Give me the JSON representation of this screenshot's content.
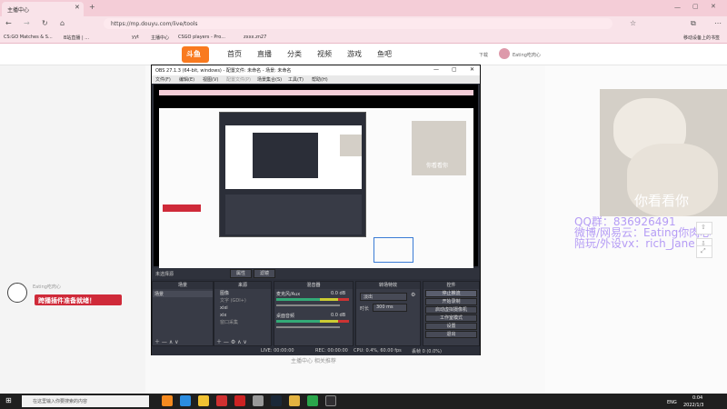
{
  "browser": {
    "tab_title": "主播中心",
    "url": "https://mp.douyu.com/live/tools",
    "bookmarks": [
      "CS:GO Matches & S...",
      "B站直播 | ...",
      "yyt",
      "主播中心",
      "CSGO players - Pro...",
      "zxxx.zn27"
    ],
    "bookmark_right": "移动设备上的书签"
  },
  "site": {
    "logo": "斗鱼",
    "nav": [
      "首页",
      "直播",
      "分类",
      "视频",
      "游戏",
      "鱼吧"
    ],
    "download": "下载",
    "user": "Eating吃肉心"
  },
  "obs": {
    "title": "OBS 27.1.3 (64-bit, windows) - 配置文件: 未命名 - 场景: 未命名",
    "menu": [
      "文件(F)",
      "编辑(E)",
      "视图(V)",
      "配置文件(P)",
      "场景集合(S)",
      "工具(T)",
      "帮助(H)"
    ],
    "no_source": "未选择源",
    "props_btn": "属性",
    "filter_btn": "滤镜",
    "docks": {
      "scenes": "场景",
      "sources": "来源",
      "mixer": "混音器",
      "transitions": "转场特效",
      "controls": "控件"
    },
    "scene_items": [
      "场景"
    ],
    "source_items": [
      "图像",
      "文字 (GDI+)",
      "xixi",
      "xix",
      "窗口采集"
    ],
    "mixer": [
      {
        "name": "桌面音频",
        "db": "0.0 dB"
      },
      {
        "name": "麦克风/Aux",
        "db": "0.0 dB"
      }
    ],
    "transition": {
      "value": "淡出",
      "duration_label": "时长",
      "duration": "300 ms"
    },
    "controls": [
      "停止推流",
      "开始录制",
      "启动虚拟摄像机",
      "工作室模式",
      "设置",
      "退出"
    ],
    "status": {
      "live": "LIVE: 00:00:00",
      "rec": "REC: 00:00:00",
      "cpu": "CPU: 0.4%, 60.00 fps",
      "drop": "丢帧 0 (0.0%)"
    }
  },
  "overlay": {
    "badge": "跨播插件准备就绪！",
    "small_text": "Eating吃肉心",
    "cat_caption": "你看看你",
    "qq_lines": [
      "QQ群：836926491",
      "微博/网易云：Eating你肉心",
      "陪玩/外设vx：rich_Jane"
    ]
  },
  "page_bottom": "主播中心 相关推荐",
  "taskbar": {
    "search_placeholder": "在这里输入你要搜索的内容",
    "lang": "ENG",
    "time": "0:04",
    "date": "2022/1/3"
  },
  "colors": {
    "accent": "#f97a1f",
    "live": "#cf2a39",
    "qq": "#b59cf5",
    "obs_bg": "#2b2e38"
  }
}
